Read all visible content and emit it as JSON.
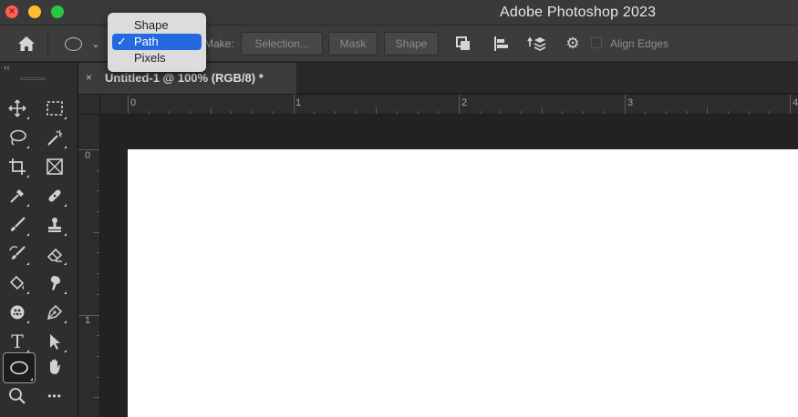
{
  "window": {
    "title": "Adobe Photoshop 2023",
    "close_glyph": "×"
  },
  "options_bar": {
    "home_icon": "home-icon",
    "tool_mode_icon": "ellipse-icon",
    "chevron": "⌄",
    "make_label": "Make:",
    "buttons": {
      "selection": "Selection...",
      "mask": "Mask",
      "shape": "Shape"
    },
    "gear": "⚙",
    "align_edges_label": "Align Edges",
    "align_edges_checked": false
  },
  "mode_dropdown": {
    "items": [
      {
        "label": "Shape",
        "selected": false
      },
      {
        "label": "Path",
        "selected": true
      },
      {
        "label": "Pixels",
        "selected": false
      }
    ],
    "check_glyph": "✓"
  },
  "toolbar": {
    "collapse_glyph": "‹‹",
    "tools": [
      "move-icon",
      "marquee-icon",
      "lasso-icon",
      "magic-wand-icon",
      "crop-icon",
      "frame-icon",
      "eyedropper-icon",
      "healing-icon",
      "brush-icon",
      "stamp-icon",
      "history-brush-icon",
      "eraser-icon",
      "paint-bucket-icon",
      "smudge-icon",
      "dodge-icon",
      "pen-icon",
      "type-icon",
      "path-selection-icon",
      "ellipse-icon",
      "hand-icon",
      "zoom-icon",
      "more-icon"
    ],
    "active_tool": "ellipse-icon",
    "type_glyph": "T",
    "more_glyph": "•••"
  },
  "document": {
    "tab_title": "Untitled-1 @ 100% (RGB/8) *",
    "tab_close": "×"
  },
  "rulers": {
    "horizontal": [
      "0",
      "1",
      "2",
      "3",
      "4"
    ],
    "vertical": [
      "0",
      "1"
    ]
  },
  "colors": {
    "chrome": "#3c3c3c",
    "toolbar": "#2e2e2e",
    "canvas_bg": "#222222",
    "document": "#ffffff",
    "selection_blue": "#2469e0",
    "close": "#ff5f57",
    "minimize": "#febc2e",
    "maximize": "#28c840"
  }
}
